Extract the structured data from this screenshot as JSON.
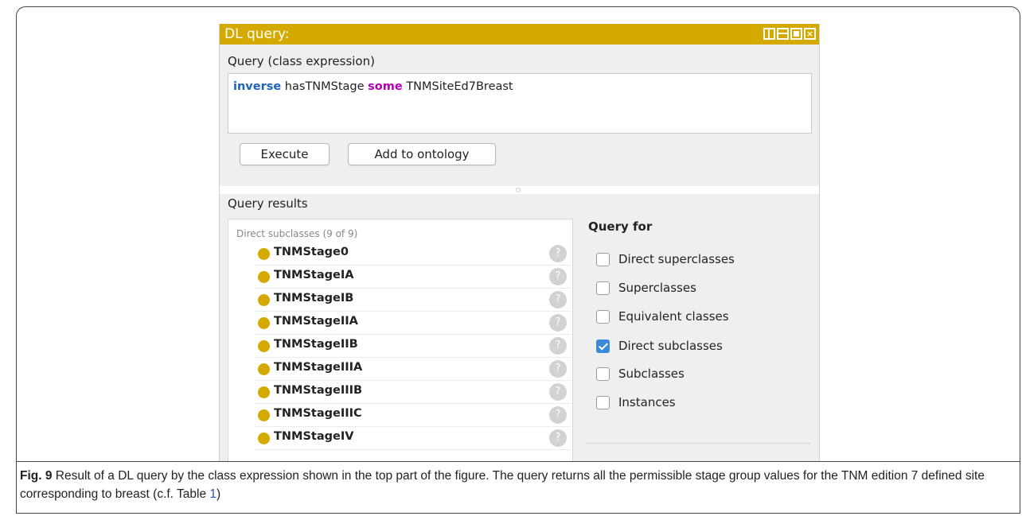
{
  "window": {
    "title": "DL query:"
  },
  "query": {
    "label": "Query (class expression)",
    "expression": {
      "kw1": "inverse",
      "part1": " hasTNMStage ",
      "kw2": "some",
      "part2": " TNMSiteEd7Breast"
    },
    "execute_label": "Execute",
    "add_label": "Add to ontology"
  },
  "results": {
    "label": "Query results",
    "header": "Direct subclasses (9 of 9)",
    "items": [
      {
        "name": "TNMStage0",
        "help": "?"
      },
      {
        "name": "TNMStageIA",
        "help": "?"
      },
      {
        "name": "TNMStageIB",
        "help": "?"
      },
      {
        "name": "TNMStageIIA",
        "help": "?"
      },
      {
        "name": "TNMStageIIB",
        "help": "?"
      },
      {
        "name": "TNMStageIIIA",
        "help": "?"
      },
      {
        "name": "TNMStageIIIB",
        "help": "?"
      },
      {
        "name": "TNMStageIIIC",
        "help": "?"
      },
      {
        "name": "TNMStageIV",
        "help": "?"
      }
    ]
  },
  "query_for": {
    "title": "Query for",
    "options": [
      {
        "label": "Direct superclasses",
        "checked": false
      },
      {
        "label": "Superclasses",
        "checked": false
      },
      {
        "label": "Equivalent classes",
        "checked": false
      },
      {
        "label": "Direct subclasses",
        "checked": true
      },
      {
        "label": "Subclasses",
        "checked": false
      },
      {
        "label": "Instances",
        "checked": false
      }
    ]
  },
  "caption": {
    "fig": "Fig. 9",
    "text_before": " Result of a DL query by the class expression shown in the top part of the figure. The query returns all the permissible stage group values for the TNM edition 7 defined site corresponding to breast (c.f. Table ",
    "link": "1",
    "text_after": ")"
  },
  "colors": {
    "title_bar": "#d5aa00",
    "class_dot": "#d5aa00",
    "keyword_blue": "#1b64b8",
    "keyword_purple": "#b400b4",
    "checkbox_checked": "#3b8bdb",
    "link": "#2a50c8"
  },
  "icons": {
    "class": "class-circle-icon",
    "help": "question-mark-icon",
    "window": [
      "split-view-icon",
      "minimize-icon",
      "maximize-icon",
      "close-icon"
    ]
  }
}
